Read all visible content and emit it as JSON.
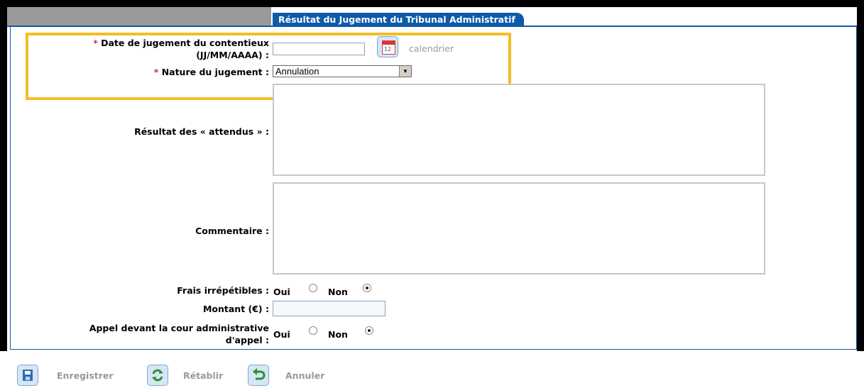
{
  "tab": {
    "label": "Résultat du Jugement du Tribunal Administratif"
  },
  "form": {
    "date": {
      "required_mark": "*",
      "label_line1": "Date de jugement du contentieux",
      "label_line2": "(JJ/MM/AAAA) :",
      "value": "",
      "calendar_label": "calendrier"
    },
    "nature": {
      "required_mark": "*",
      "label": "Nature du jugement :",
      "selected": "Annulation"
    },
    "resultat": {
      "label": "Résultat des « attendus » :",
      "value": ""
    },
    "commentaire": {
      "label": "Commentaire :",
      "value": ""
    },
    "frais": {
      "label": "Frais irrépétibles :",
      "oui": "Oui",
      "non": "Non",
      "selected": "Non"
    },
    "montant": {
      "label": "Montant (€) :",
      "value": ""
    },
    "appel": {
      "label_line1": "Appel devant la cour administrative",
      "label_line2": "d'appel :",
      "oui": "Oui",
      "non": "Non",
      "selected": "Non"
    }
  },
  "actions": {
    "save": "Enregistrer",
    "restore": "Rétablir",
    "cancel": "Annuler"
  },
  "colors": {
    "accent": "#0d5aa8",
    "highlight": "#f4bd25",
    "required": "#e12828"
  },
  "icons": {
    "calendar": "calendar-icon",
    "save": "save-icon",
    "restore": "refresh-icon",
    "cancel": "undo-icon"
  }
}
